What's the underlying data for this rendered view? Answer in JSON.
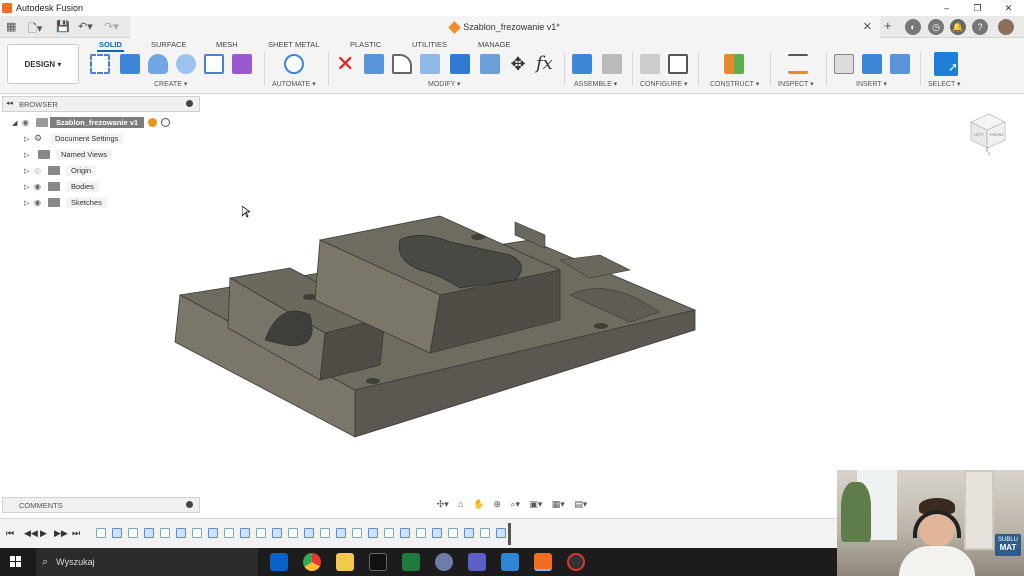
{
  "window": {
    "app_title": "Autodesk Fusion",
    "controls": {
      "minimize": "–",
      "maximize": "❐",
      "close": "✕"
    }
  },
  "document_tab": {
    "name": "Szablon_frezowanie v1*",
    "close": "✕"
  },
  "ribbon": {
    "workspace_button": "DESIGN ▾",
    "tabs": [
      {
        "label": "SOLID",
        "active": true
      },
      {
        "label": "SURFACE",
        "active": false
      },
      {
        "label": "MESH",
        "active": false
      },
      {
        "label": "SHEET METAL",
        "active": false
      },
      {
        "label": "PLASTIC",
        "active": false
      },
      {
        "label": "UTILITIES",
        "active": false
      },
      {
        "label": "MANAGE",
        "active": false
      }
    ],
    "groups": [
      {
        "label": "CREATE ▾"
      },
      {
        "label": "AUTOMATE ▾"
      },
      {
        "label": "MODIFY ▾"
      },
      {
        "label": "ASSEMBLE ▾"
      },
      {
        "label": "CONFIGURE ▾"
      },
      {
        "label": "CONSTRUCT ▾"
      },
      {
        "label": "INSPECT ▾"
      },
      {
        "label": "INSERT ▾"
      },
      {
        "label": "SELECT ▾"
      }
    ],
    "accent": "#0a66c2"
  },
  "browser": {
    "title": "BROWSER",
    "root": "Szablon_frezowanie v1",
    "items": [
      {
        "label": "Document Settings"
      },
      {
        "label": "Named Views"
      },
      {
        "label": "Origin"
      },
      {
        "label": "Bodies"
      },
      {
        "label": "Sketches"
      }
    ]
  },
  "viewcube": {
    "faces": [
      "LEFT",
      "FRONT"
    ],
    "axis_label": "Z"
  },
  "comments": {
    "title": "COMMENTS"
  },
  "taskbar": {
    "search_text": "Wyszukaj"
  },
  "webcam": {
    "badge_top": "SUBLU",
    "badge_bottom": "MAT"
  }
}
